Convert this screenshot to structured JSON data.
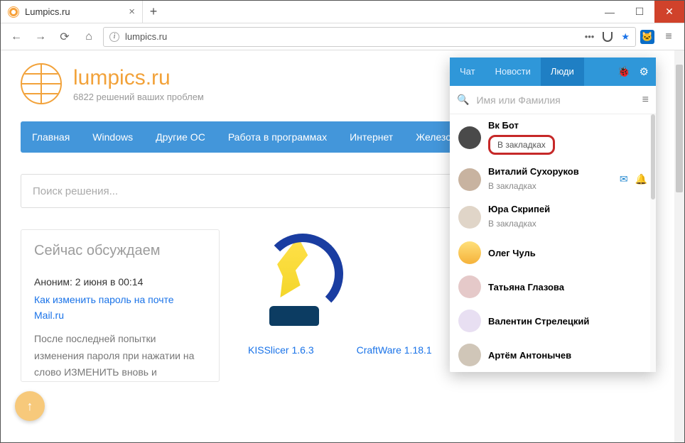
{
  "tab": {
    "title": "Lumpics.ru"
  },
  "url": "lumpics.ru",
  "brand": {
    "name": "lumpics.ru",
    "sub": "6822 решений ваших проблем"
  },
  "nav": [
    "Главная",
    "Windows",
    "Другие ОС",
    "Работа в программах",
    "Интернет",
    "Железо"
  ],
  "search_placeholder": "Поиск решения...",
  "discuss": {
    "heading": "Сейчас обсуждаем",
    "meta": "Аноним: 2 июня в 00:14",
    "link": "Как изменить пароль на почте Mail.ru",
    "body": "После последней попытки изменения пароля при нажатии на слово ИЗМЕНИТЬ вновь и"
  },
  "items": [
    {
      "name": "KISSlicer 1.6.3"
    },
    {
      "name": "CraftWare 1.18.1"
    }
  ],
  "popup": {
    "tabs": [
      "Чат",
      "Новости",
      "Люди"
    ],
    "active_tab": "Люди",
    "search_placeholder": "Имя или Фамилия",
    "people": [
      {
        "name": "Вк Бот",
        "sub": "В закладках",
        "hl": true
      },
      {
        "name": "Виталий Сухоруков",
        "sub": "В закладках",
        "actions": true
      },
      {
        "name": "Юра Скрипей",
        "sub": "В закладках"
      },
      {
        "name": "Олег Чуль"
      },
      {
        "name": "Татьяна Глазова"
      },
      {
        "name": "Валентин Стрелецкий"
      },
      {
        "name": "Артём Антонычев"
      }
    ]
  }
}
